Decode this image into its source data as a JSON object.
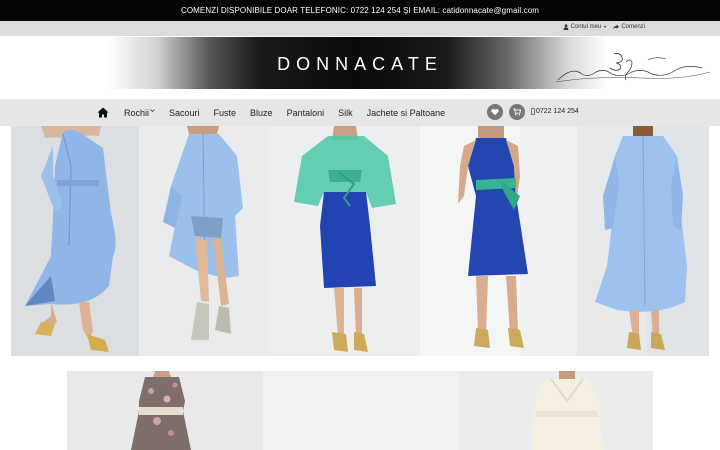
{
  "announcement": "COMENZI DISPONIBILE DOAR TELEFONIC: 0722 124 254 ŞI EMAIL: catidonnacate@gmail.com",
  "account": {
    "my_account": "Contul meu",
    "orders": "Comenzi"
  },
  "brand": {
    "logo": "DONNACATE"
  },
  "nav": {
    "items": [
      {
        "label": "Rochii",
        "has_dropdown": true
      },
      {
        "label": "Sacouri"
      },
      {
        "label": "Fuste"
      },
      {
        "label": "Bluze"
      },
      {
        "label": "Pantaloni"
      },
      {
        "label": "Silk"
      },
      {
        "label": "Jachete si Paltoane"
      }
    ],
    "phone": "0722 124 254"
  },
  "icons": {
    "home": "home-icon",
    "wishlist": "heart-icon",
    "cart": "cart-icon",
    "phone": "mobile-phone-icon",
    "user": "user-icon",
    "orders": "share-arrow-icon"
  },
  "colors": {
    "topbar": "#050505",
    "account_bar": "#dcdcdc",
    "nav_bar": "#e6e6e6",
    "nav_circle": "#777777"
  }
}
